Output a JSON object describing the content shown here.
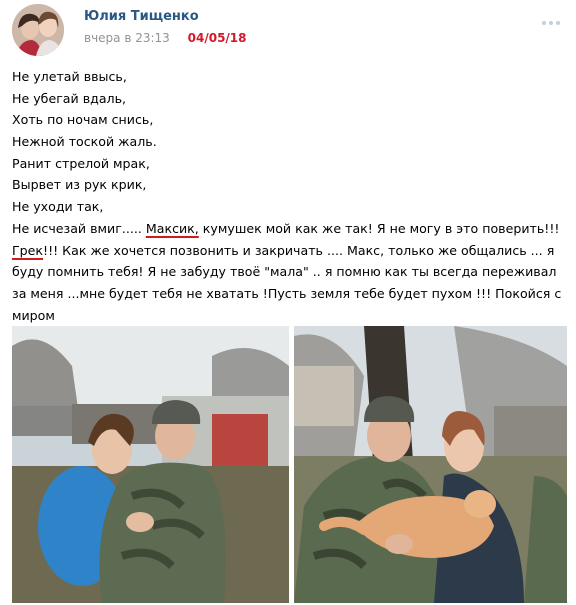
{
  "post": {
    "author": "Юлия Тищенко",
    "time": "вчера в 23:13",
    "date_stamp": "04/05/18",
    "text": {
      "lines": [
        "Не улетай ввысь,",
        "Не убегай вдаль,",
        "Хоть по ночам снись,",
        "Нежной тоской жаль.",
        "Ранит стрелой мрак,",
        "Вырвет из рук крик,",
        "Не уходи так,"
      ],
      "line8_prefix": "Не исчезай вмиг..... ",
      "line8_name": "Максик,",
      "line8_suffix": " кумушек мой как же так! Я не могу в это поверить!!!",
      "paragraph_name": "Грек",
      "paragraph_rest": "!!! Как же хочется позвонить и закричать .... Макс, только же общались ... я буду помнить тебя! Я не забуду твоё \"мала\" .. я помню как ты всегда переживал за меня ...мне будет тебя не хватать !Пусть земля тебе будет пухом !!! Покойся с миром"
    },
    "icons": {
      "more": "more-dots-icon"
    },
    "colors": {
      "author": "#2a5885",
      "meta": "#939393",
      "stamp": "#d3182a",
      "underline": "#d11a1a"
    }
  }
}
